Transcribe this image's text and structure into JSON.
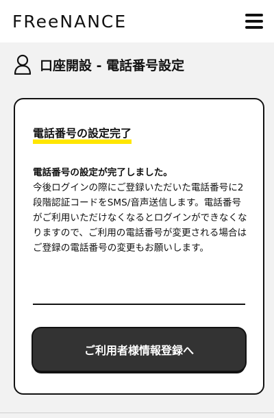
{
  "header": {
    "logo_text": "FReeNANCE",
    "menu_icon": "hamburger-menu-icon"
  },
  "page": {
    "title": "口座開設 - 電話番号設定",
    "title_icon": "user-icon"
  },
  "card": {
    "heading": "電話番号の設定完了",
    "highlight_color": "#ffe600",
    "message_bold": "電話番号の設定が完了しました。",
    "message_body": "今後ログインの際にご登録いただいた電話番号に2段階認証コードをSMS/音声送信します。電話番号がご利用いただけなくなるとログインができなくなりますので、ご利用の電話番号が変更される場合はご登録の電話番号の変更もお願いします。",
    "button_label": "ご利用者様情報登録へ",
    "button_color": "#333333"
  }
}
